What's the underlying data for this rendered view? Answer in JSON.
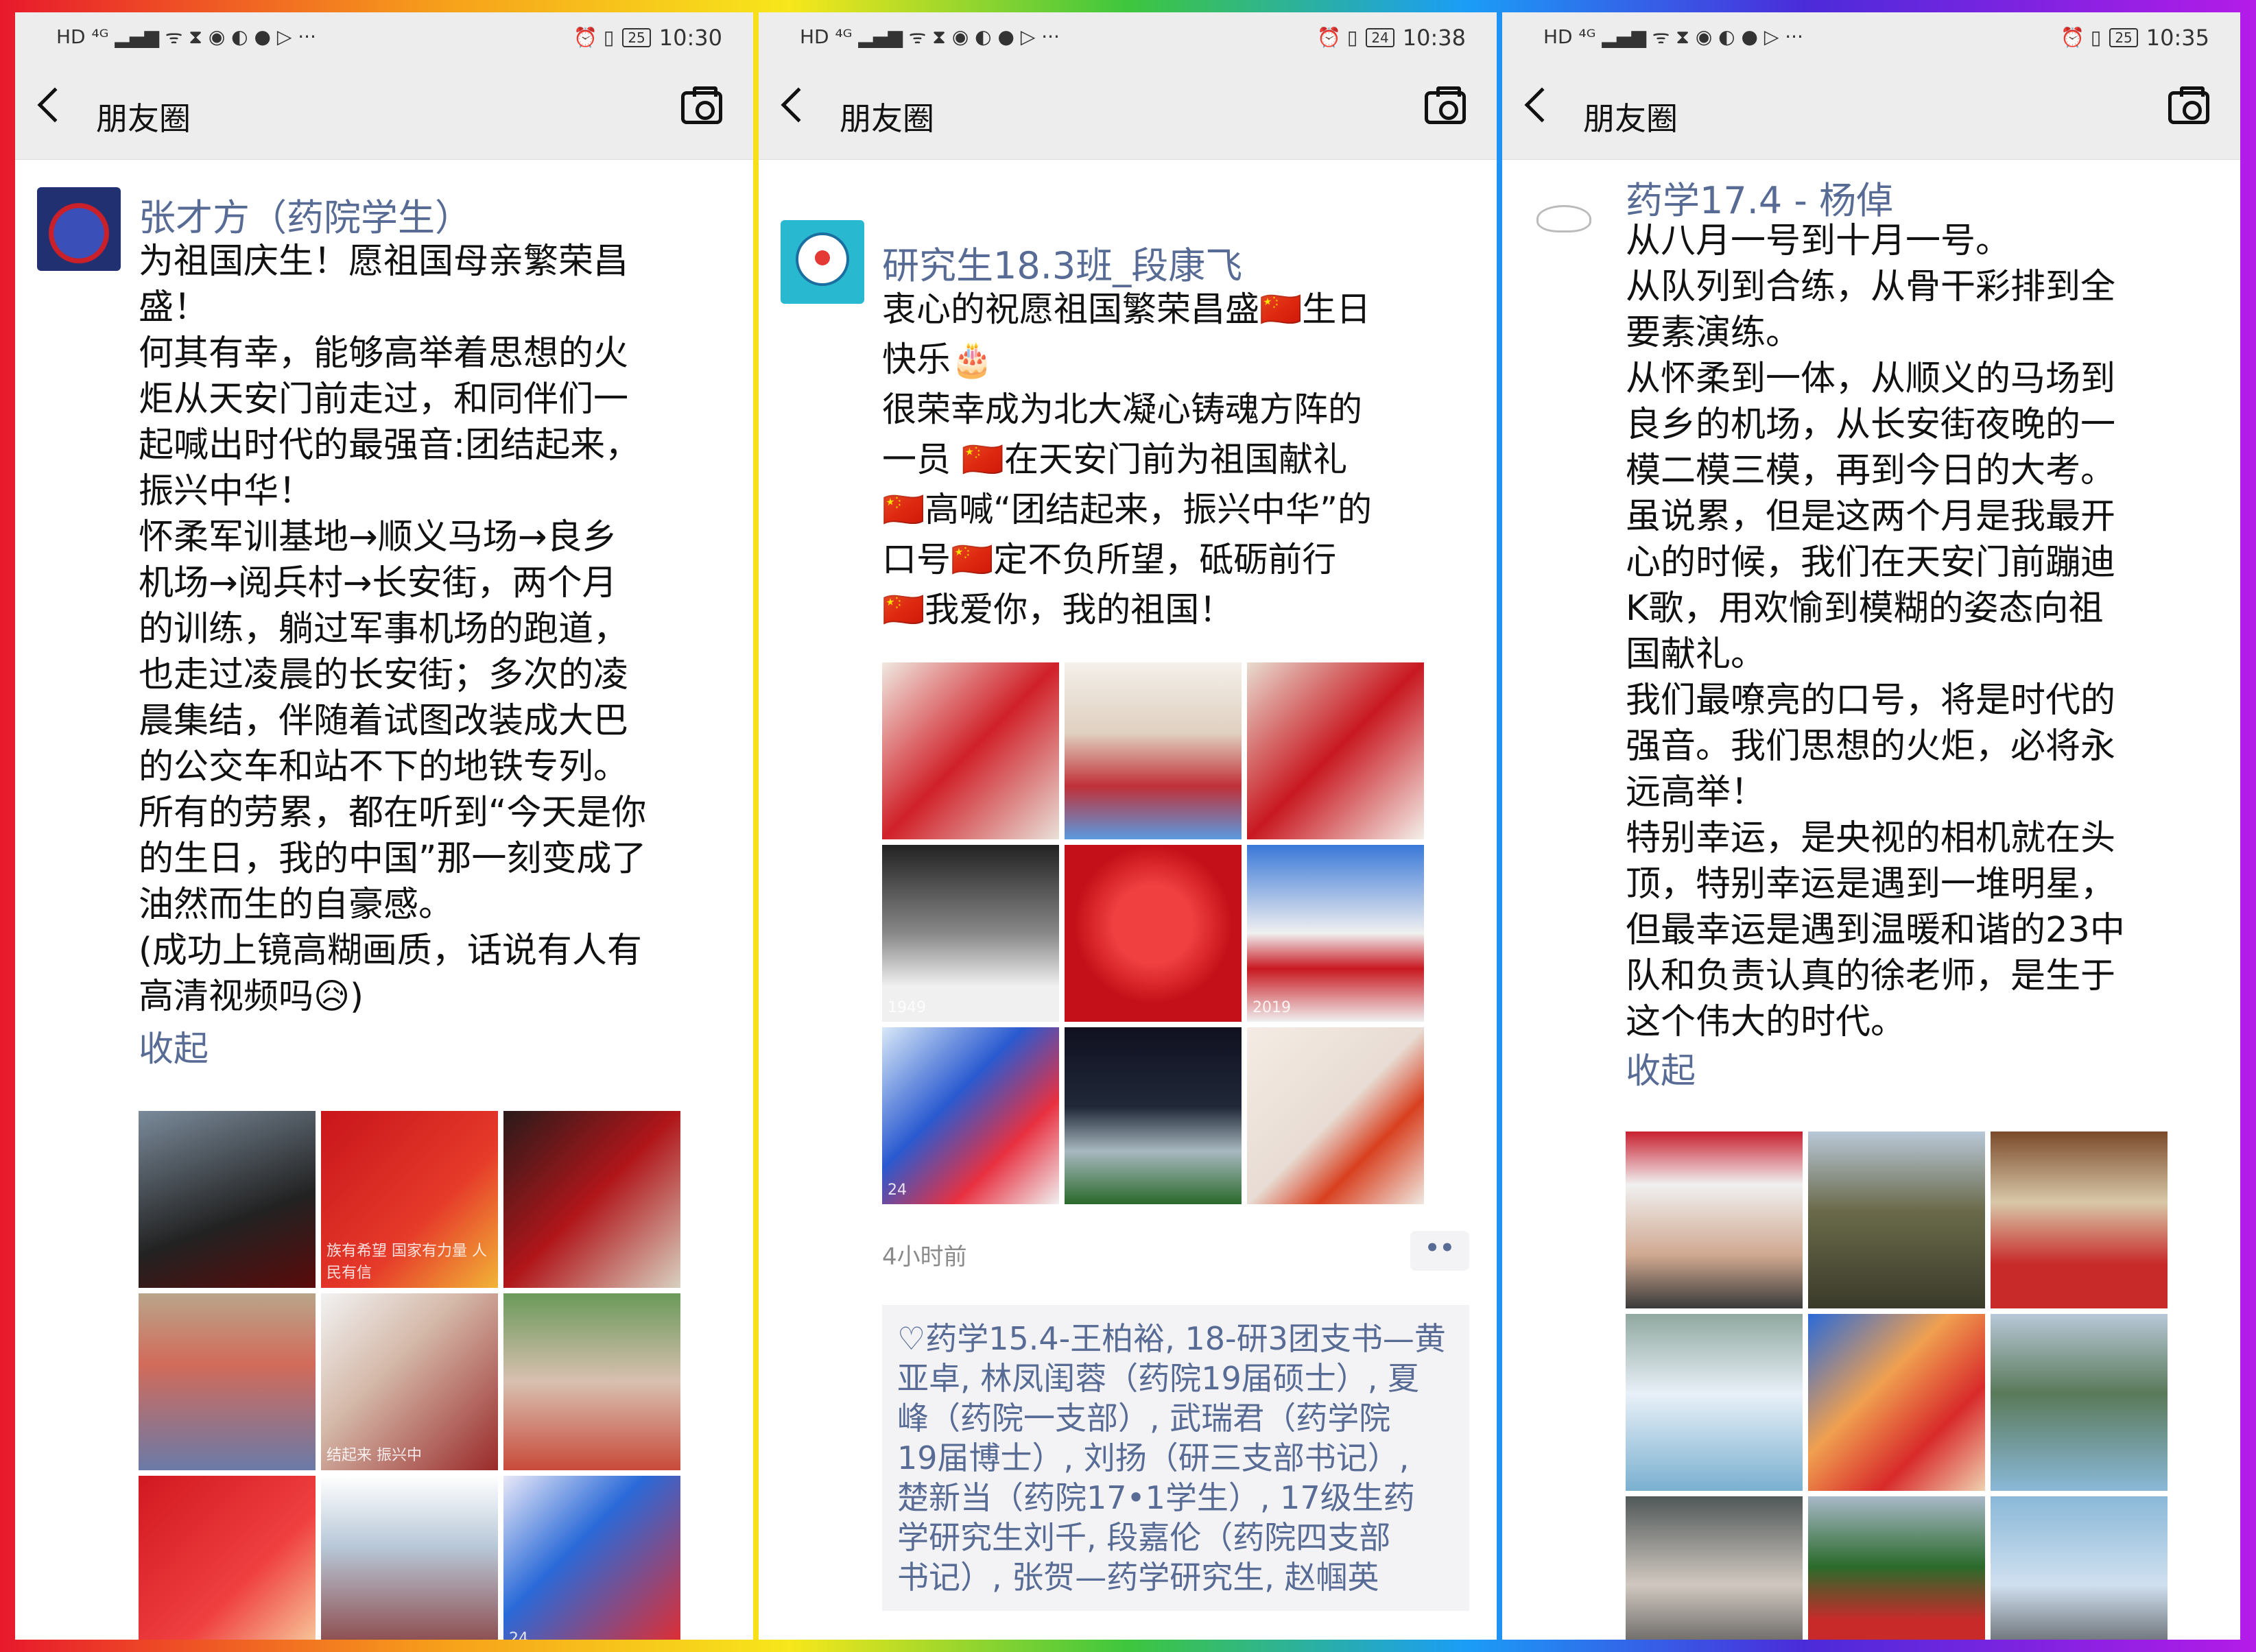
{
  "colors": {
    "name": "#576b95",
    "bar": "#ededed",
    "text": "#111111"
  },
  "panels": [
    {
      "status": {
        "time": "10:30",
        "battery": "25",
        "left_icons": "HD ⁴ᴳ ▂▄▆ ᯤ ⧗ ◉ ◐ ● ▷ ···",
        "right_icons": "⏰ ▯"
      },
      "nav": {
        "title": "朋友圈"
      },
      "post": {
        "author": "张才方（药院学生）",
        "lines": [
          "为祖国庆生！愿祖国母亲繁荣昌",
          "盛！",
          "何其有幸，能够高举着思想的火",
          "炬从天安门前走过，和同伴们一",
          "起喊出时代的最强音:团结起来，",
          "振兴中华！",
          "怀柔军训基地→顺义马场→良乡",
          "机场→阅兵村→长安街，两个月",
          "的训练，躺过军事机场的跑道，",
          "也走过凌晨的长安街；多次的凌",
          "晨集结，伴随着试图改装成大巴",
          "的公交车和站不下的地铁专列。",
          "所有的劳累，都在听到“今天是你",
          "的生日，我的中国”那一刻变成了",
          "油然而生的自豪感。",
          "(成功上镜高糊画质，话说有人有",
          "高清视频吗😥)"
        ],
        "collapse": "收起",
        "photos": [
          {
            "bg": "linear-gradient(160deg,#7a8a9a,#222 60%,#5a0a0a)"
          },
          {
            "bg": "linear-gradient(135deg,#c8151b,#e63a2a 60%,#f2b437)",
            "text": "族有希望 国家有力量 人民有信"
          },
          {
            "bg": "linear-gradient(135deg,#2a1a1a,#b0161a 50%,#d8d0c0)"
          },
          {
            "bg": "linear-gradient(180deg,#b9a58a,#d26b5a 40%,#6a7aa8)"
          },
          {
            "bg": "linear-gradient(135deg,#f2f2f2,#d4b8a8 40%,#9a2a2a)",
            "text": "结起来 振兴中"
          },
          {
            "bg": "linear-gradient(180deg,#6a9a5a,#d8c0b0 50%,#c84a3a)"
          },
          {
            "bg": "linear-gradient(135deg,#d01820,#f04040 60%,#f8d0a0)"
          },
          {
            "bg": "linear-gradient(180deg,#ffffff,#b8c8d8 40%,#884040)"
          },
          {
            "bg": "linear-gradient(135deg,#e8e8f8,#2a6ad8 40%,#e82a2a)",
            "text": "24"
          }
        ]
      }
    },
    {
      "status": {
        "time": "10:38",
        "battery": "24",
        "left_icons": "HD ⁴ᴳ ▂▄▆ ᯤ ⧗ ◉ ◐ ● ▷ ···",
        "right_icons": "⏰ ▯"
      },
      "nav": {
        "title": "朋友圈"
      },
      "post": {
        "author": "研究生18.3班_段康飞",
        "lines": [
          "衷心的祝愿祖国繁荣昌盛🇨🇳生日",
          "快乐🎂",
          "很荣幸成为北大凝心铸魂方阵的",
          "一员 🇨🇳在天安门前为祖国献礼",
          "🇨🇳高喊“团结起来，振兴中华”的",
          "口号🇨🇳定不负所望，砥砺前行",
          "🇨🇳我爱你，我的祖国！"
        ],
        "photos": [
          {
            "bg": "linear-gradient(135deg,#f0e8e0,#d02028 50%,#e8e0d8)"
          },
          {
            "bg": "linear-gradient(180deg,#f4f0ea,#e0d0c0 40%,#c03038 70%,#5a9ae0)"
          },
          {
            "bg": "linear-gradient(135deg,#e8dcd0,#c81820 50%,#f4f0ea)"
          },
          {
            "bg": "linear-gradient(180deg,#222,#888 50%,#f0f0f0 80%)",
            "text": "1949"
          },
          {
            "bg": "radial-gradient(circle at 50% 45%,#f04040 0 30%,#c41018 60%)"
          },
          {
            "bg": "linear-gradient(180deg,#3a78d8,#f0f0f0 50%,#c81820 70%,#f0f0f0)",
            "text": "2019"
          },
          {
            "bg": "linear-gradient(135deg,#d8e8f8,#2a5ad0 40%,#e83040 70%,#f0f0f0)",
            "text": "24"
          },
          {
            "bg": "linear-gradient(180deg,#101020,#202838 45%,#a8b8c0 70%,#2a6a2a)"
          },
          {
            "bg": "linear-gradient(135deg,#f4ece4,#e8dcd4 50%,#d84020 70%,#f0e8e0)"
          }
        ],
        "time": "4小时前",
        "dots": "••",
        "likes": [
          "♡药学15.4-王柏裕, 18-研3团支书—黄",
          "亚卓, 林凤闺蓉（药院19届硕士）, 夏",
          "峰（药院一支部）, 武瑞君（药学院",
          "19届博士）, 刘扬（研三支部书记）,",
          "楚新当（药院17•1学生）, 17级生药",
          "学研究生刘千, 段嘉伦（药院四支部",
          "书记）, 张贺—药学研究生, 赵帼英"
        ]
      }
    },
    {
      "status": {
        "time": "10:35",
        "battery": "25",
        "left_icons": "HD ⁴ᴳ ▂▄▆ ᯤ ⧗ ◉ ◐ ● ▷ ···",
        "right_icons": "⏰ ▯"
      },
      "nav": {
        "title": "朋友圈"
      },
      "post": {
        "author": "药学17.4 - 杨倬",
        "lines": [
          "从八月一号到十月一号。",
          "从队列到合练，从骨干彩排到全",
          "要素演练。",
          "从怀柔到一体，从顺义的马场到",
          "良乡的机场，从长安街夜晚的一",
          "模二模三模，再到今日的大考。",
          "虽说累，但是这两个月是我最开",
          "心的时候，我们在天安门前蹦迪",
          "K歌，用欢愉到模糊的姿态向祖",
          "国献礼。",
          "我们最嘹亮的口号，将是时代的",
          "强音。我们思想的火炬，必将永",
          "远高举！",
          "特别幸运，是央视的相机就在头",
          "顶，特别幸运是遇到一堆明星，",
          "但最幸运是遇到温暖和谐的23中",
          "队和负责认真的徐老师，是生于",
          "这个伟大的时代。"
        ],
        "collapse": "收起",
        "photos": [
          {
            "bg": "linear-gradient(180deg,#c82030,#f0f0f0 30%,#d0a890 70%,#3a3a3a)"
          },
          {
            "bg": "linear-gradient(180deg,#b8c8d8,#6a6a4a 45%,#3a3a2a)"
          },
          {
            "bg": "linear-gradient(180deg,#7a4a2a,#d8c8a8 40%,#c82a2a 75%)"
          },
          {
            "bg": "linear-gradient(180deg,#90a8a0,#e8f0f8 45%,#7ab0d0)"
          },
          {
            "bg": "linear-gradient(135deg,#2a6ad8,#f0a050 40%,#d82a2a 70%,#f0d0b0)"
          },
          {
            "bg": "linear-gradient(180deg,#b8c8d8,#5a7a5a 45%,#8ab8d8)"
          },
          {
            "bg": "linear-gradient(180deg,#505858,#d0c8c0 50%,#3a3a3a)"
          },
          {
            "bg": "linear-gradient(180deg,#a8b8c8,#2a6a2a 40%,#c82a2a 70%)"
          },
          {
            "bg": "linear-gradient(180deg,#8ab8d8,#d0e0f0 50%,#3a3a3a)"
          }
        ]
      }
    }
  ]
}
